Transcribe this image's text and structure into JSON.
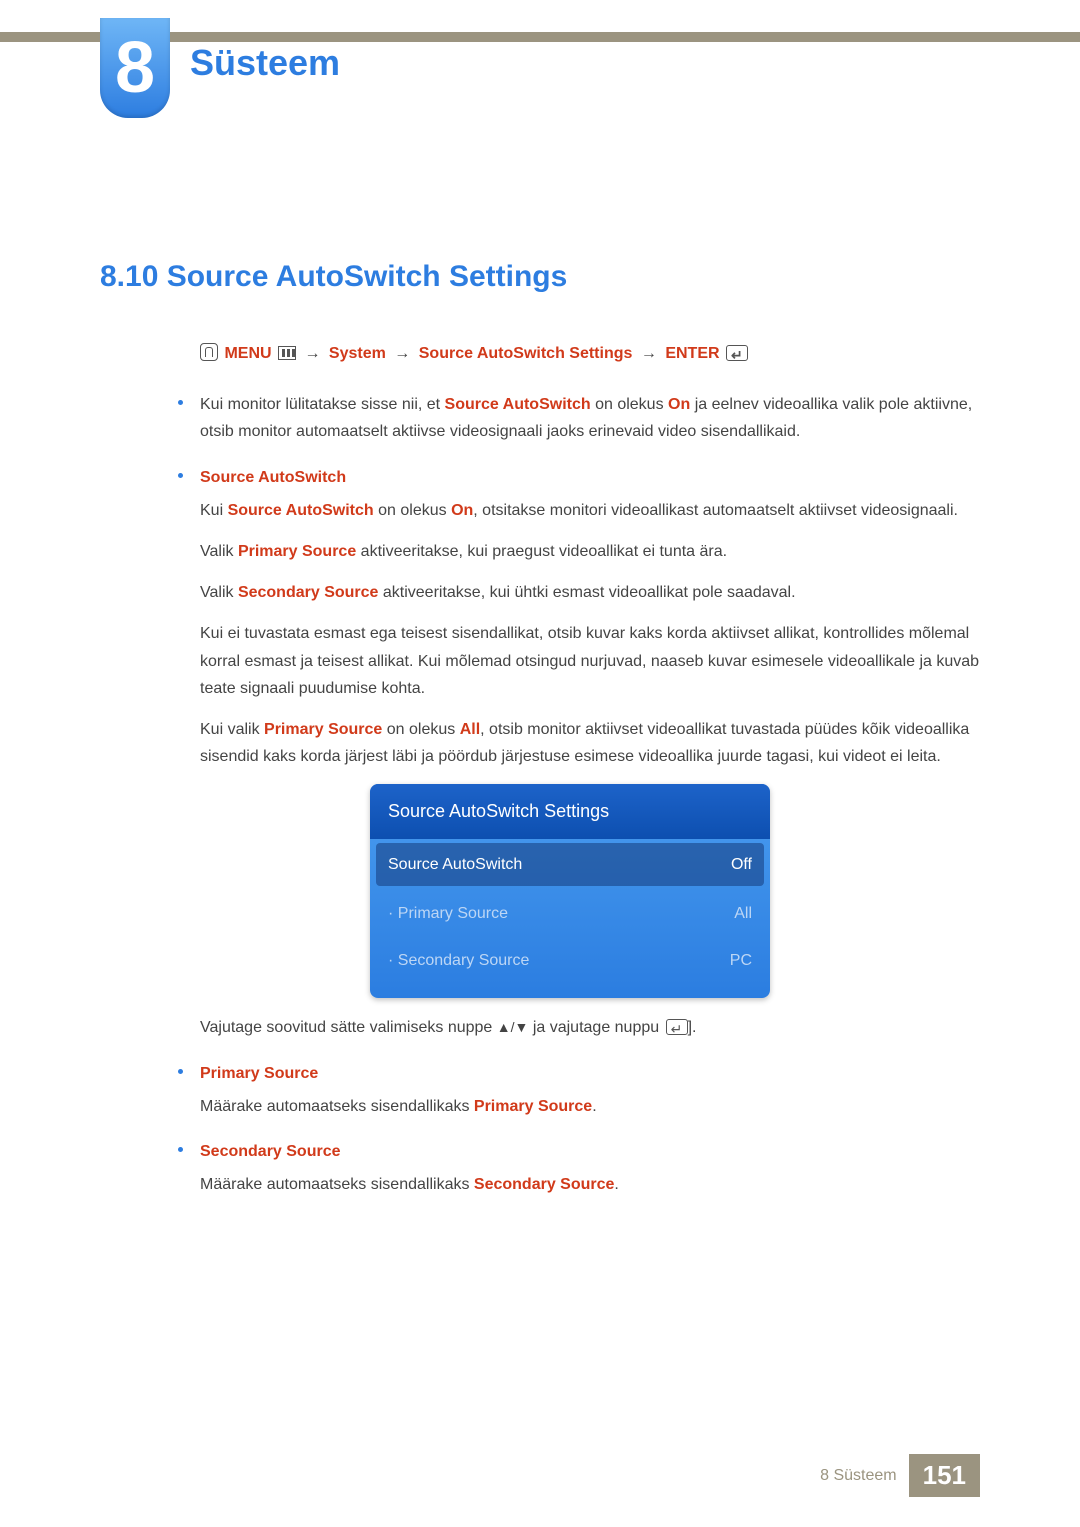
{
  "chapter": {
    "number": "8",
    "title": "Süsteem"
  },
  "section": {
    "number_title": "8.10  Source AutoSwitch Settings"
  },
  "menuPath": {
    "menu": "MENU",
    "system": "System",
    "sas": "Source AutoSwitch Settings",
    "enter": "ENTER"
  },
  "intro": {
    "pre": "Kui monitor lülitatakse sisse nii, et ",
    "kw1": "Source AutoSwitch",
    "mid": " on olekus ",
    "kw2": "On",
    "post": " ja eelnev videoallika valik pole aktiivne, otsib monitor automaatselt aktiivse videosignaali jaoks erinevaid video sisendallikaid."
  },
  "sourceAuto": {
    "title": "Source AutoSwitch",
    "p1a": "Kui ",
    "p1k1": "Source AutoSwitch",
    "p1b": " on olekus ",
    "p1k2": "On",
    "p1c": ", otsitakse monitori videoallikast automaatselt aktiivset videosignaali.",
    "p2a": "Valik ",
    "p2k": "Primary Source",
    "p2b": " aktiveeritakse, kui praegust videoallikat ei tunta ära.",
    "p3a": "Valik ",
    "p3k": "Secondary Source",
    "p3b": " aktiveeritakse, kui ühtki esmast videoallikat pole saadaval.",
    "p4": "Kui ei tuvastata esmast ega teisest sisendallikat, otsib kuvar kaks korda aktiivset allikat, kontrollides mõlemal korral esmast ja teisest allikat. Kui mõlemad otsingud nurjuvad, naaseb kuvar esimesele videoallikale ja kuvab teate signaali puudumise kohta.",
    "p5a": "Kui valik ",
    "p5k1": "Primary Source",
    "p5b": " on olekus ",
    "p5k2": "All",
    "p5c": ", otsib monitor aktiivset videoallikat tuvastada püüdes kõik videoallika sisendid kaks korda järjest läbi ja pöördub järjestuse esimese videoallika juurde tagasi, kui videot ei leita."
  },
  "osd": {
    "header": "Source AutoSwitch Settings",
    "row1": {
      "label": "Source AutoSwitch",
      "value": "Off"
    },
    "row2": {
      "label": "· Primary Source",
      "value": "All"
    },
    "row3": {
      "label": "· Secondary Source",
      "value": "PC"
    }
  },
  "navHint": {
    "pre": "Vajutage soovitud sätte valimiseks nuppe ",
    "arrows": "▲/▼",
    "mid": " ja vajutage nuppu ",
    "post": "]."
  },
  "primary": {
    "title": "Primary Source",
    "textA": "Määrake automaatseks sisendallikaks ",
    "kw": "Primary Source",
    "textB": "."
  },
  "secondary": {
    "title": "Secondary Source",
    "textA": "Määrake automaatseks sisendallikaks ",
    "kw": "Secondary Source",
    "textB": "."
  },
  "footer": {
    "label": "8 Süsteem",
    "page": "151"
  }
}
